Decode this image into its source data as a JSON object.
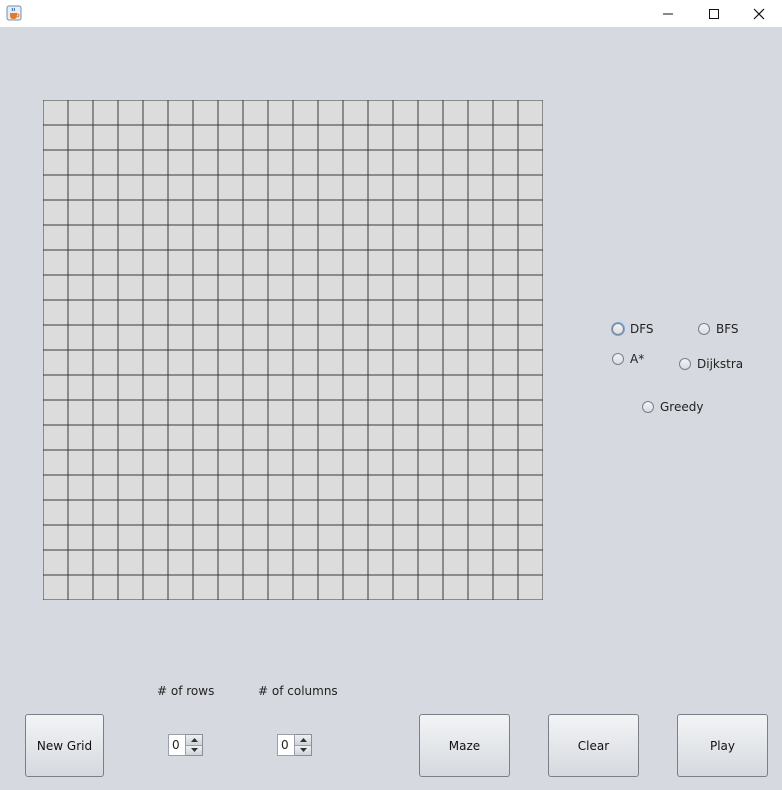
{
  "window": {
    "title_icon": "java-cup-icon",
    "controls": [
      "minimize-icon",
      "maximize-icon",
      "close-icon"
    ]
  },
  "grid": {
    "rows": 20,
    "cols": 20,
    "cell_color": "#dcdcdc",
    "line_color": "#3a3a3a"
  },
  "algorithms": {
    "dfs": "DFS",
    "bfs": "BFS",
    "astar": "A*",
    "dijkstra": "Dijkstra",
    "greedy": "Greedy"
  },
  "controls": {
    "new_grid": "New Grid",
    "rows_label": "# of rows",
    "rows_value": "0",
    "cols_label": "# of columns",
    "cols_value": "0",
    "maze": "Maze",
    "clear": "Clear",
    "play": "Play"
  }
}
